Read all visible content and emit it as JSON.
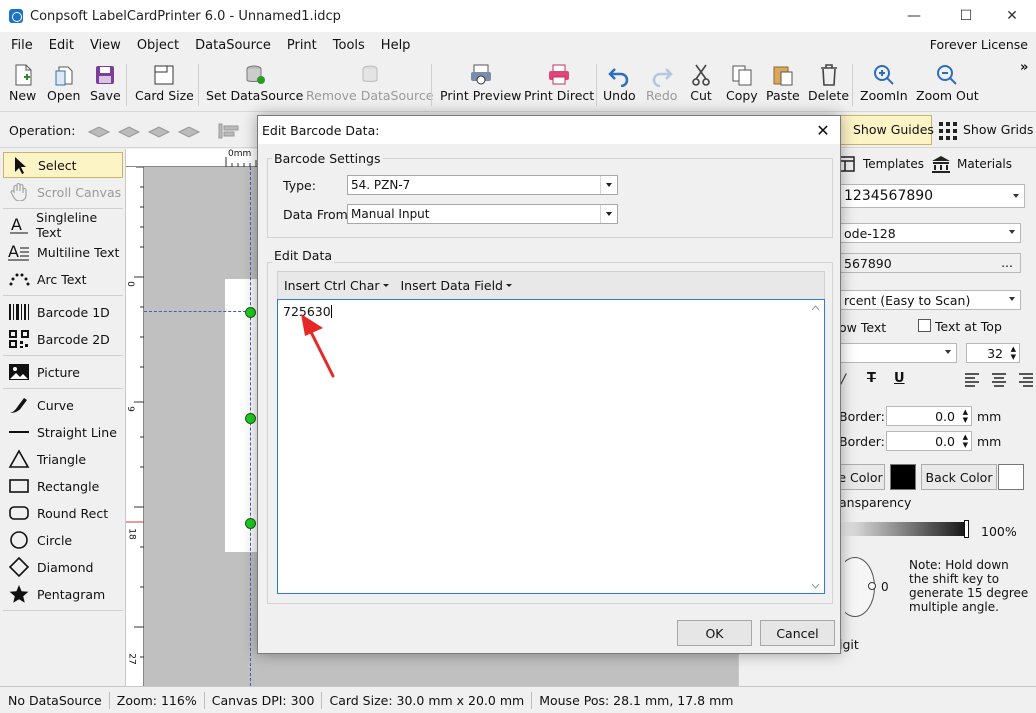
{
  "window": {
    "title": "Conpsoft LabelCardPrinter 6.0 - Unnamed1.idcp",
    "controls": {
      "minimize": "—",
      "maximize": "☐",
      "close": "✕"
    }
  },
  "menu": {
    "items": [
      "File",
      "Edit",
      "View",
      "Object",
      "DataSource",
      "Print",
      "Tools",
      "Help"
    ],
    "license": "Forever License"
  },
  "toolbar": {
    "new": "New",
    "open": "Open",
    "save": "Save",
    "card_size": "Card Size",
    "set_datasource": "Set DataSource",
    "remove_datasource": "Remove DataSource",
    "print_preview": "Print Preview",
    "print_direct": "Print Direct",
    "undo": "Undo",
    "redo": "Redo",
    "cut": "Cut",
    "copy": "Copy",
    "paste": "Paste",
    "delete": "Delete",
    "zoom_in": "ZoomIn",
    "zoom_out": "Zoom Out",
    "overflow": "»"
  },
  "operation_bar": {
    "label": "Operation:",
    "show_guides": "Show Guides",
    "show_grids": "Show Grids"
  },
  "tools": {
    "select": "Select",
    "scroll_canvas": "Scroll Canvas",
    "singleline_text": "Singleline Text",
    "multiline_text": "Multiline Text",
    "arc_text": "Arc Text",
    "barcode_1d": "Barcode 1D",
    "barcode_2d": "Barcode 2D",
    "picture": "Picture",
    "curve": "Curve",
    "straight_line": "Straight Line",
    "triangle": "Triangle",
    "rectangle": "Rectangle",
    "round_rect": "Round Rect",
    "circle": "Circle",
    "diamond": "Diamond",
    "pentagram": "Pentagram"
  },
  "canvas": {
    "ruler_unit": "0mm",
    "ruler_marks": [
      "0",
      "9",
      "18",
      "27"
    ]
  },
  "right_panel": {
    "tab_templates": "Templates",
    "tab_materials": "Materials",
    "data_value": "1234567890",
    "barcode_type": "ode-128",
    "data_source_value": "567890",
    "browse": "...",
    "readability": "rcent (Easy to Scan)",
    "show_text": "ow Text",
    "text_at_top": "Text at Top",
    "font_size": "32",
    "style_strike": "T",
    "style_underline": "U",
    "border1_label": "Border:",
    "border1_value": "0.0",
    "border1_unit": "mm",
    "border2_label": "Border:",
    "border2_value": "0.0",
    "border2_unit": "mm",
    "fore_color": "e Color",
    "back_color": "Back Color",
    "transparency": "ansparency",
    "transparency_value": "100%",
    "rotation_angle": "0",
    "note": "Note: Hold down the shift key to generate 15 degree multiple angle.",
    "check_digit": "igit",
    "colors": {
      "fore": "#000000",
      "back": "#ffffff"
    }
  },
  "status": {
    "datasource": "No DataSource",
    "zoom": "Zoom: 116%",
    "dpi": "Canvas DPI: 300",
    "card_size": "Card Size: 30.0 mm x 20.0 mm",
    "mouse_pos": "Mouse Pos: 28.1 mm, 17.8 mm"
  },
  "dialog": {
    "title": "Edit Barcode Data:",
    "close": "✕",
    "barcode_settings": "Barcode Settings",
    "type_label": "Type:",
    "type_value": "54. PZN-7",
    "data_from_label": "Data From:",
    "data_from_value": "Manual Input",
    "edit_data": "Edit Data",
    "insert_ctrl_char": "Insert Ctrl Char",
    "insert_data_field": "Insert Data Field",
    "data_text": "725630",
    "ok": "OK",
    "cancel": "Cancel"
  },
  "accent_colors": {
    "selection": "#fdf4c6",
    "guide_handle": "#22cc22",
    "annotation_arrow": "#e62828",
    "focus_border": "#2f7bd8"
  }
}
